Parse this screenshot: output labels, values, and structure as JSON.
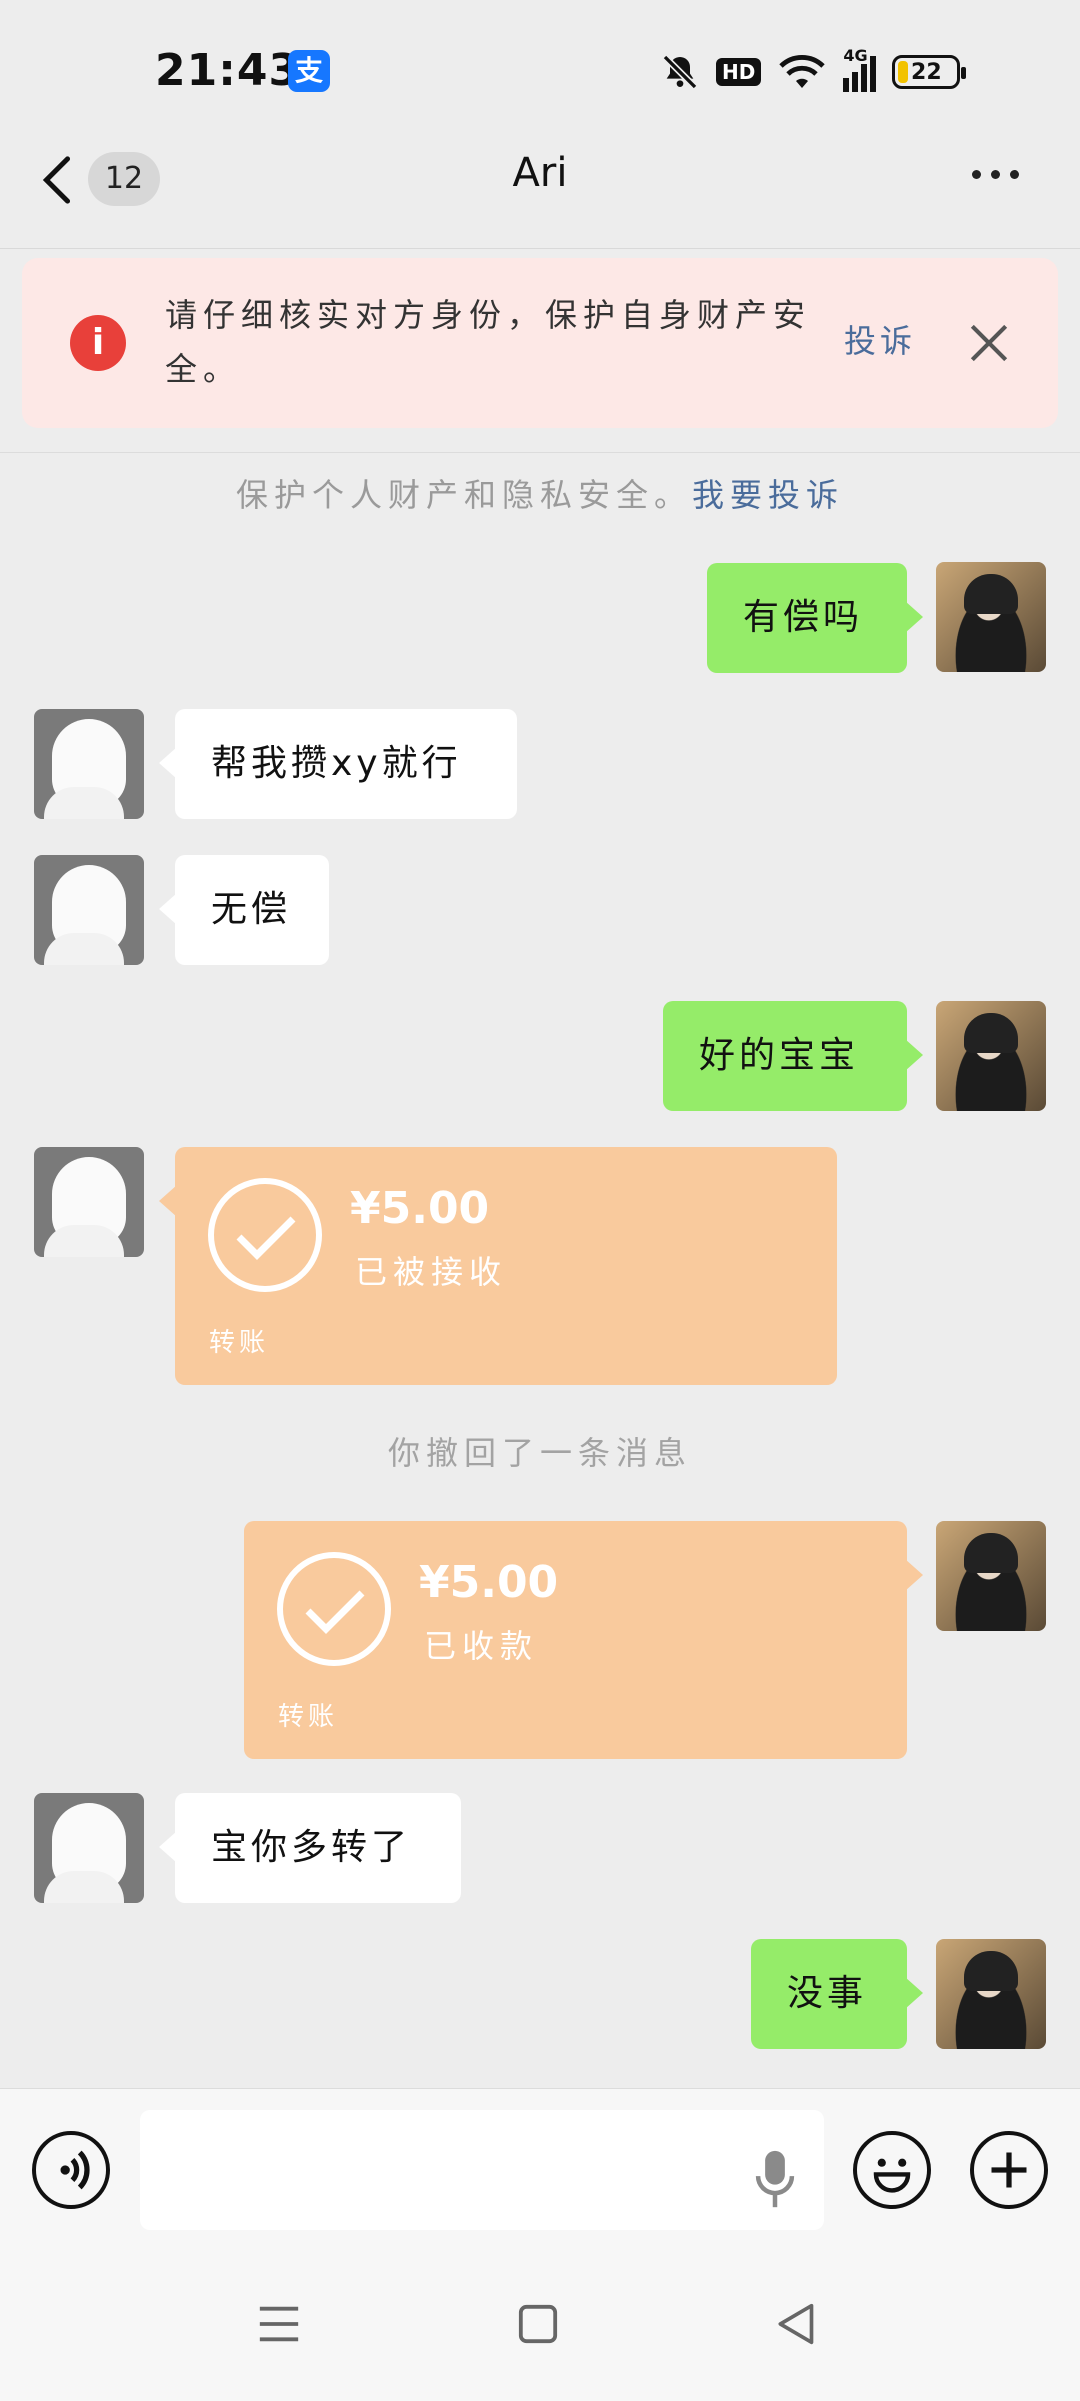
{
  "status_bar": {
    "time": "21:43",
    "alipay_glyph": "支",
    "icons": [
      "mute-bell-icon",
      "hd-icon",
      "wifi-icon",
      "4g-signal-icon"
    ],
    "hd_label": "HD",
    "network_label": "4G",
    "battery_level": "22"
  },
  "header": {
    "unread_count": "12",
    "title": "Ari"
  },
  "warning": {
    "icon_glyph": "i",
    "text": "请仔细核实对方身份，保护自身财产安全。",
    "report_label": "投诉"
  },
  "safety_notice": {
    "text": "保护个人财产和隐私安全。",
    "link": "我要投诉"
  },
  "messages": [
    {
      "side": "right",
      "type": "text",
      "text": "有偿吗"
    },
    {
      "side": "left",
      "type": "text",
      "text": "帮我攒xy就行"
    },
    {
      "side": "left",
      "type": "text",
      "text": "无偿"
    },
    {
      "side": "right",
      "type": "text",
      "text": "好的宝宝"
    },
    {
      "side": "left",
      "type": "transfer",
      "amount": "¥5.00",
      "status": "已被接收",
      "label": "转账"
    },
    {
      "side": "center",
      "type": "system",
      "text": "你撤回了一条消息"
    },
    {
      "side": "right",
      "type": "transfer",
      "amount": "¥5.00",
      "status": "已收款",
      "label": "转账"
    },
    {
      "side": "left",
      "type": "text",
      "text": "宝你多转了"
    },
    {
      "side": "right",
      "type": "text",
      "text": "没事"
    }
  ],
  "colors": {
    "bubble_right": "#95ec69",
    "bubble_left": "#ffffff",
    "transfer_card": "#f9ca9d",
    "warning_bg": "#fde8e6",
    "warning_icon": "#e8403a",
    "link": "#4a6c9b"
  }
}
